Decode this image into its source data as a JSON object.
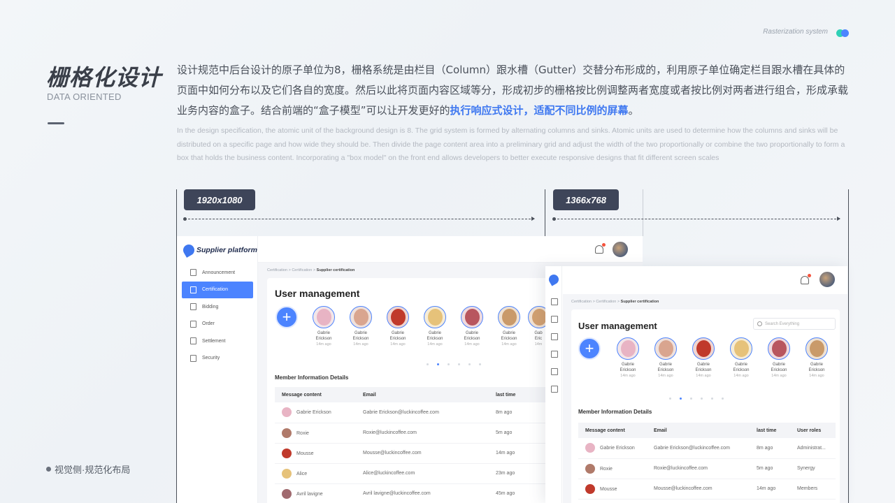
{
  "header": {
    "system_tag": "Rasterization system",
    "title": "栅格化设计",
    "subtitle": "DATA ORIENTED",
    "footer_note": "视觉侧·规范化布局"
  },
  "intro": {
    "cn_text": "设计规范中后台设计的原子单位为8，栅格系统是由栏目（Column）跟水槽（Gutter）交替分布形成的，利用原子单位确定栏目跟水槽在具体的页面中如何分布以及它们各自的宽度。然后以此将页面内容区域等分，形成初步的栅格按比例调整两者宽度或者按比例对两者进行组合，形成承载业务内容的盒子。结合前端的“盒子模型”可以让开发更好的",
    "cn_highlight": "执行响应式设计，适配不同比例的屏幕",
    "cn_end": "。",
    "en_text": "In the design specification, the atomic unit of the background design is 8. The grid system is formed by alternating columns and sinks. Atomic units are used to determine how the columns and sinks will be distributed on a specific page and how wide they should be. Then divide the page content area into a preliminary grid and adjust the width of the two proportionally or combine the two proportionally to form a box that holds the business content. Incorporating a \"box model\" on the front end allows developers to better execute responsive designs that fit different screen scales"
  },
  "sizes": {
    "large": "1920x1080",
    "small": "1366x768"
  },
  "app": {
    "logo_text": "Supplier platform",
    "menu": [
      {
        "label": "Announcement",
        "active": false
      },
      {
        "label": "Certification",
        "active": true
      },
      {
        "label": "Bidding",
        "active": false
      },
      {
        "label": "Order",
        "active": false
      },
      {
        "label": "Settlement",
        "active": false
      },
      {
        "label": "Security",
        "active": false
      }
    ],
    "breadcrumb": {
      "a": "Certification",
      "b": "Certification",
      "current": "Supplier certification"
    },
    "page_title": "User management",
    "search_placeholder": "Search Everything",
    "people": [
      {
        "name1": "Gabrie",
        "name2": "Erickson",
        "time": "14m ago",
        "color": "#e8b4c4"
      },
      {
        "name1": "Gabrie",
        "name2": "Erickson",
        "time": "14m ago",
        "color": "#d9a58f"
      },
      {
        "name1": "Gabrie",
        "name2": "Erickson",
        "time": "14m ago",
        "color": "#c0392b"
      },
      {
        "name1": "Gabrie",
        "name2": "Erickson",
        "time": "14m ago",
        "color": "#e6c27a"
      },
      {
        "name1": "Gabrie",
        "name2": "Erickson",
        "time": "14m ago",
        "color": "#b8565f"
      },
      {
        "name1": "Gabrie",
        "name2": "Erickson",
        "time": "14m ago",
        "color": "#c99a6a"
      },
      {
        "name1": "Gab",
        "name2": "Eric",
        "time": "14m",
        "color": "#d2a070"
      }
    ],
    "section_title": "Member Information Details",
    "table": {
      "headers": [
        "Message content",
        "Email",
        "last time",
        "User roles"
      ],
      "rows": [
        {
          "name": "Gabrie Erickson",
          "email": "Gabrie Erickson@luckincoffee.com",
          "time": "8m ago",
          "role": "Administrat...",
          "color": "#e8b4c4"
        },
        {
          "name": "Roxie",
          "email": "Roxie@luckincoffee.com",
          "time": "5m ago",
          "role": "Synergy",
          "color": "#b07a6a"
        },
        {
          "name": "Mousse",
          "email": "Mousse@luckincoffee.com",
          "time": "14m ago",
          "role": "Members",
          "color": "#c0392b"
        },
        {
          "name": "Alice",
          "email": "Alice@luckincoffee.com",
          "time": "23m ago",
          "role": "",
          "color": "#e6c27a"
        },
        {
          "name": "Avril lavigne",
          "email": "Avril lavigne@luckincoffee.com",
          "time": "45m ago",
          "role": "",
          "color": "#a06a6f"
        }
      ]
    }
  },
  "colors": {
    "accent": "#4c84ff",
    "highlight_text": "#3f78f0",
    "badge": "#3e4559",
    "notify": "#f5533d"
  }
}
